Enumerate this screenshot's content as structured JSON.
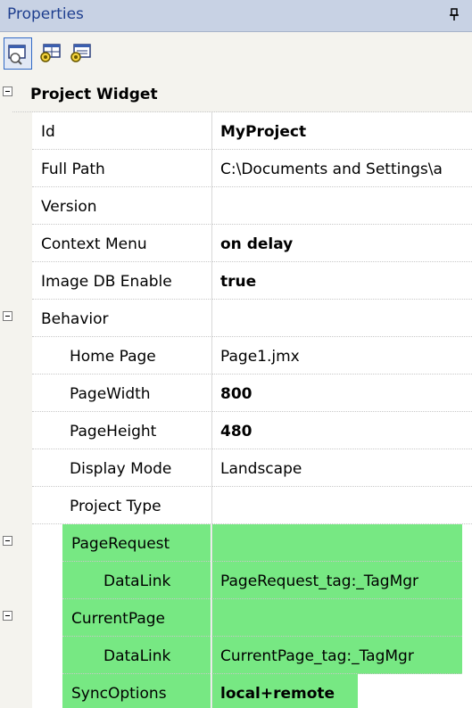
{
  "panel": {
    "title": "Properties",
    "pin_icon": "pin-icon"
  },
  "toolbar": {
    "buttons": [
      {
        "icon": "properties-view-icon",
        "active": true
      },
      {
        "icon": "events-icon",
        "active": false
      },
      {
        "icon": "categorized-view-icon",
        "active": false
      }
    ]
  },
  "grid": {
    "sections": {
      "project_widget": "Project Widget",
      "behavior": "Behavior"
    },
    "rows": {
      "id": {
        "name": "Id",
        "value": "MyProject"
      },
      "full_path": {
        "name": "Full Path",
        "value": "C:\\Documents and Settings\\a"
      },
      "version": {
        "name": "Version",
        "value": ""
      },
      "context_menu": {
        "name": "Context Menu",
        "value": "on delay"
      },
      "image_db_enable": {
        "name": "Image DB Enable",
        "value": "true"
      },
      "home_page": {
        "name": "Home Page",
        "value": "Page1.jmx"
      },
      "page_width": {
        "name": "PageWidth",
        "value": "800"
      },
      "page_height": {
        "name": "PageHeight",
        "value": "480"
      },
      "display_mode": {
        "name": "Display Mode",
        "value": "Landscape"
      },
      "project_type": {
        "name": "Project Type",
        "value": ""
      },
      "page_request": {
        "name": "PageRequest",
        "value": ""
      },
      "page_request_datalink": {
        "name": "DataLink",
        "value": "PageRequest_tag:_TagMgr"
      },
      "current_page": {
        "name": "CurrentPage",
        "value": ""
      },
      "current_page_datalink": {
        "name": "DataLink",
        "value": "CurrentPage_tag:_TagMgr"
      },
      "sync_options": {
        "name": "SyncOptions",
        "value": "local+remote"
      }
    }
  },
  "colors": {
    "title_bg": "#c8d2e4",
    "title_text": "#1f3f8f",
    "highlight_green": "#77e883",
    "gutter": "#f4f3ee"
  }
}
